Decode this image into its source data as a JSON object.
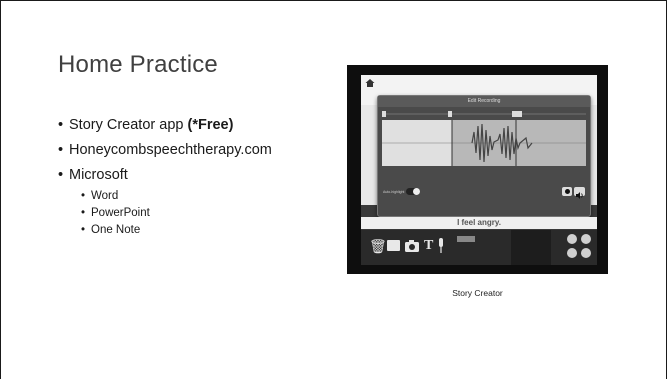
{
  "slide": {
    "title": "Home Practice",
    "bullets": [
      {
        "text": "Story Creator app ",
        "bold": "(*Free)"
      },
      {
        "text": "Honeycombspeechtherapy.com"
      },
      {
        "text": "Microsoft"
      }
    ],
    "sub_bullets": [
      "Word",
      "PowerPoint",
      "One Note"
    ],
    "image_caption": "Story Creator"
  },
  "screenshot": {
    "dialog_title": "Edit Recording",
    "toggle_label": "Auto-highlight",
    "story_text": "I feel angry.",
    "icons": [
      "home-icon",
      "trash-icon",
      "image-icon",
      "camera-icon",
      "text-icon",
      "microphone-icon",
      "grid-icon"
    ]
  }
}
